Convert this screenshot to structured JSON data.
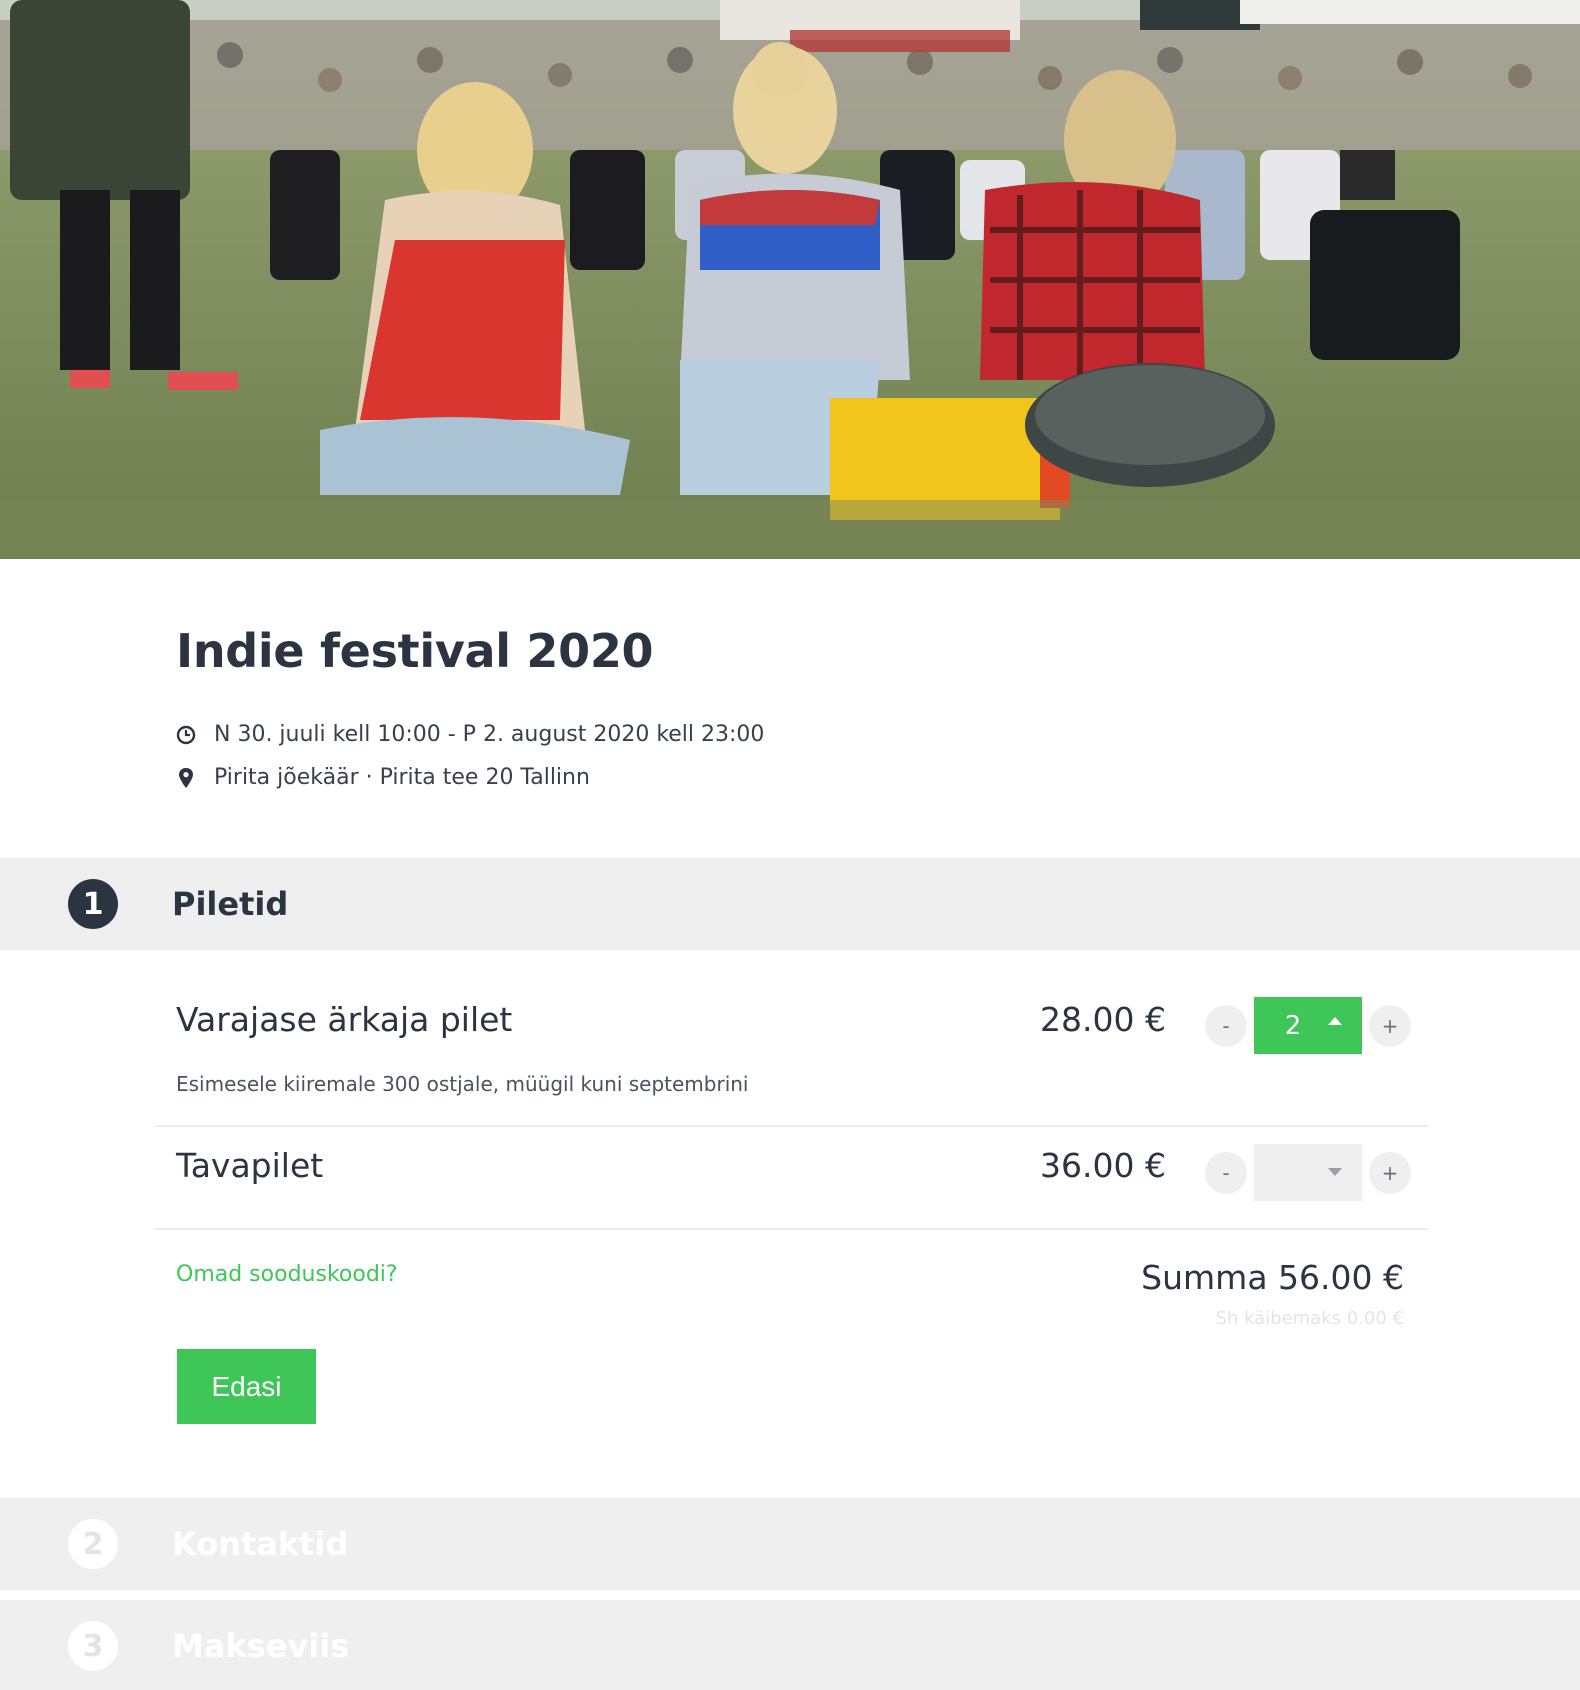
{
  "event": {
    "title": "Indie festival 2020",
    "date_range": "N 30. juuli kell 10:00 - P 2. august 2020 kell 23:00",
    "location": "Pirita jõekäär · Pirita tee 20 Tallinn",
    "hero_image": "festival-crowd-photo"
  },
  "steps": [
    {
      "number": "1",
      "label": "Piletid",
      "state": "active"
    },
    {
      "number": "2",
      "label": "Kontaktid",
      "state": "inactive"
    },
    {
      "number": "3",
      "label": "Makseviis",
      "state": "inactive"
    }
  ],
  "tickets": [
    {
      "name": "Varajase ärkaja pilet",
      "description": "Esimesele kiiremale 300 ostjale, müügil kuni septembrini",
      "price": "28.00 €",
      "quantity": "2",
      "minus": "-",
      "plus": "+"
    },
    {
      "name": "Tavapilet",
      "description": "",
      "price": "36.00 €",
      "quantity": "",
      "minus": "-",
      "plus": "+"
    }
  ],
  "summary": {
    "promo_link": "Omad sooduskoodi?",
    "total": "Summa 56.00 €",
    "vat": "Sh käibemaks 0.00 €"
  },
  "actions": {
    "next_label": "Edasi"
  },
  "colors": {
    "accent": "#3ec758",
    "dark": "#2b3441",
    "step_bg": "#efefef"
  },
  "icons": {
    "date": "clock-icon",
    "location": "map-pin-icon",
    "qty_up": "caret-up-icon",
    "qty_down": "caret-down-icon"
  }
}
